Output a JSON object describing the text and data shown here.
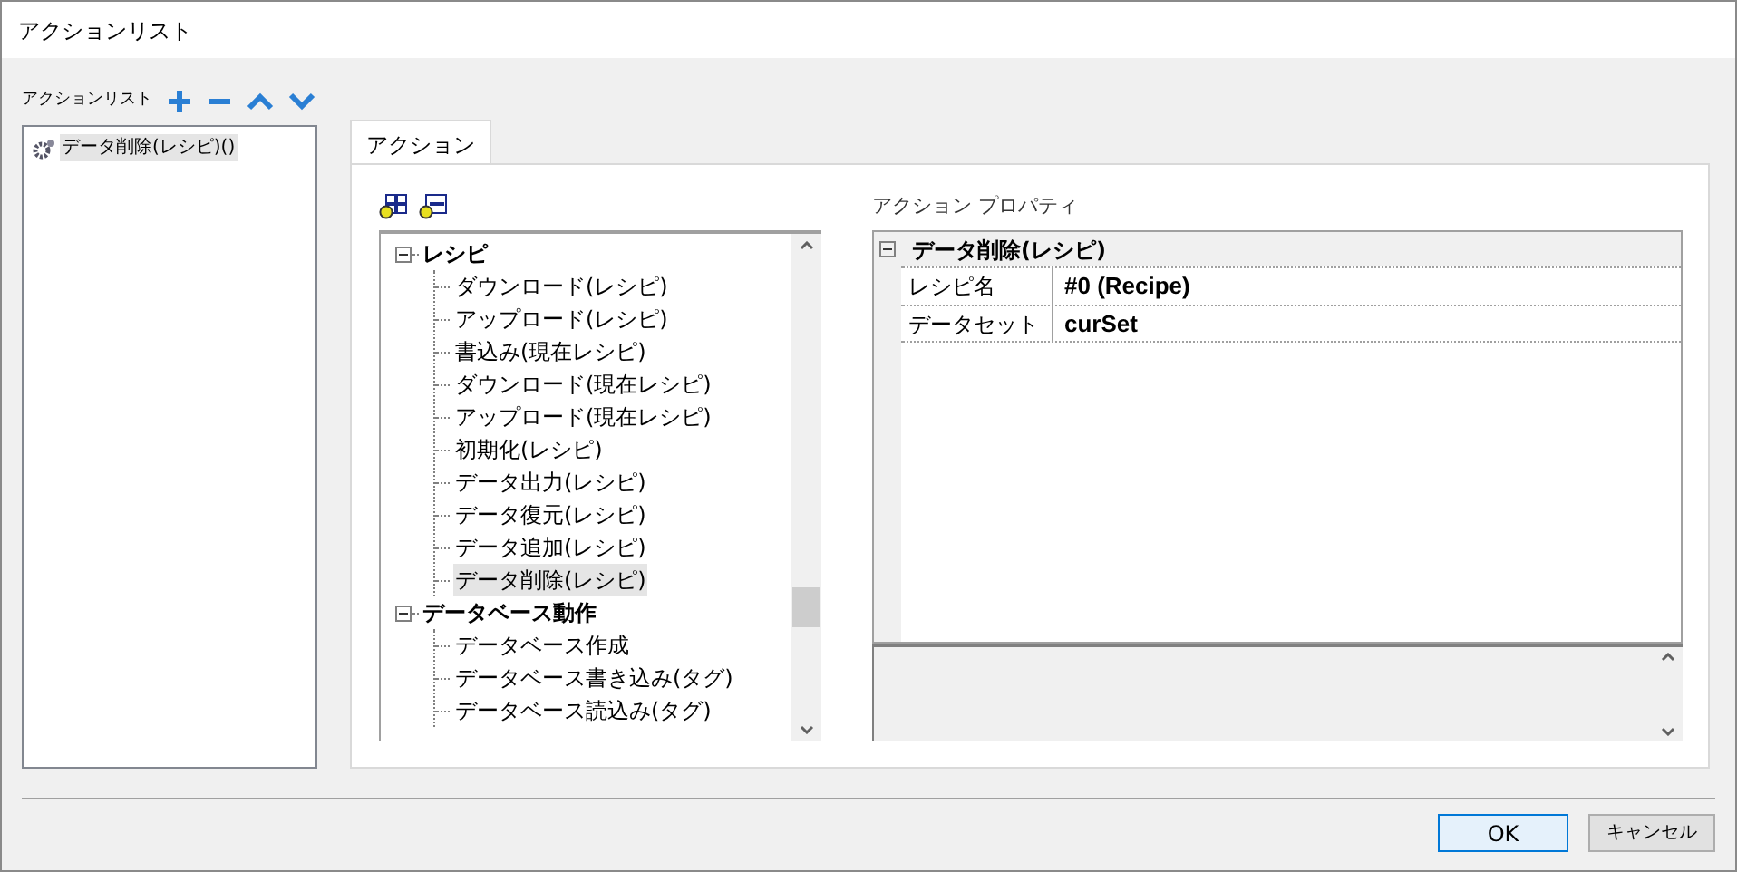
{
  "window": {
    "title": "アクションリスト"
  },
  "action_list": {
    "label": "アクションリスト",
    "items": [
      {
        "label": "データ削除(レシピ)()",
        "selected": true
      }
    ]
  },
  "tabs": [
    {
      "label": "アクション",
      "selected": true
    }
  ],
  "tree": {
    "items": [
      {
        "label": "レシピ",
        "expanded": true,
        "children": [
          {
            "label": "ダウンロード(レシピ)",
            "selected": false
          },
          {
            "label": "アップロード(レシピ)",
            "selected": false
          },
          {
            "label": "書込み(現在レシピ)",
            "selected": false
          },
          {
            "label": "ダウンロード(現在レシピ)",
            "selected": false
          },
          {
            "label": "アップロード(現在レシピ)",
            "selected": false
          },
          {
            "label": "初期化(レシピ)",
            "selected": false
          },
          {
            "label": "データ出力(レシピ)",
            "selected": false
          },
          {
            "label": "データ復元(レシピ)",
            "selected": false
          },
          {
            "label": "データ追加(レシピ)",
            "selected": false
          },
          {
            "label": "データ削除(レシピ)",
            "selected": true
          }
        ]
      },
      {
        "label": "データベース動作",
        "expanded": true,
        "children": [
          {
            "label": "データベース作成",
            "selected": false
          },
          {
            "label": "データベース書き込み(タグ)",
            "selected": false
          },
          {
            "label": "データベース読込み(タグ)",
            "selected": false
          }
        ]
      }
    ]
  },
  "properties": {
    "label": "アクション プロパティ",
    "category": "データ削除(レシピ)",
    "rows": [
      {
        "name": "レシピ名",
        "value": "#0 (Recipe)"
      },
      {
        "name": "データセット",
        "value": "curSet"
      }
    ]
  },
  "buttons": [
    {
      "label": "OK",
      "kind": "default"
    },
    {
      "label": "キャンセル",
      "kind": "normal"
    }
  ]
}
